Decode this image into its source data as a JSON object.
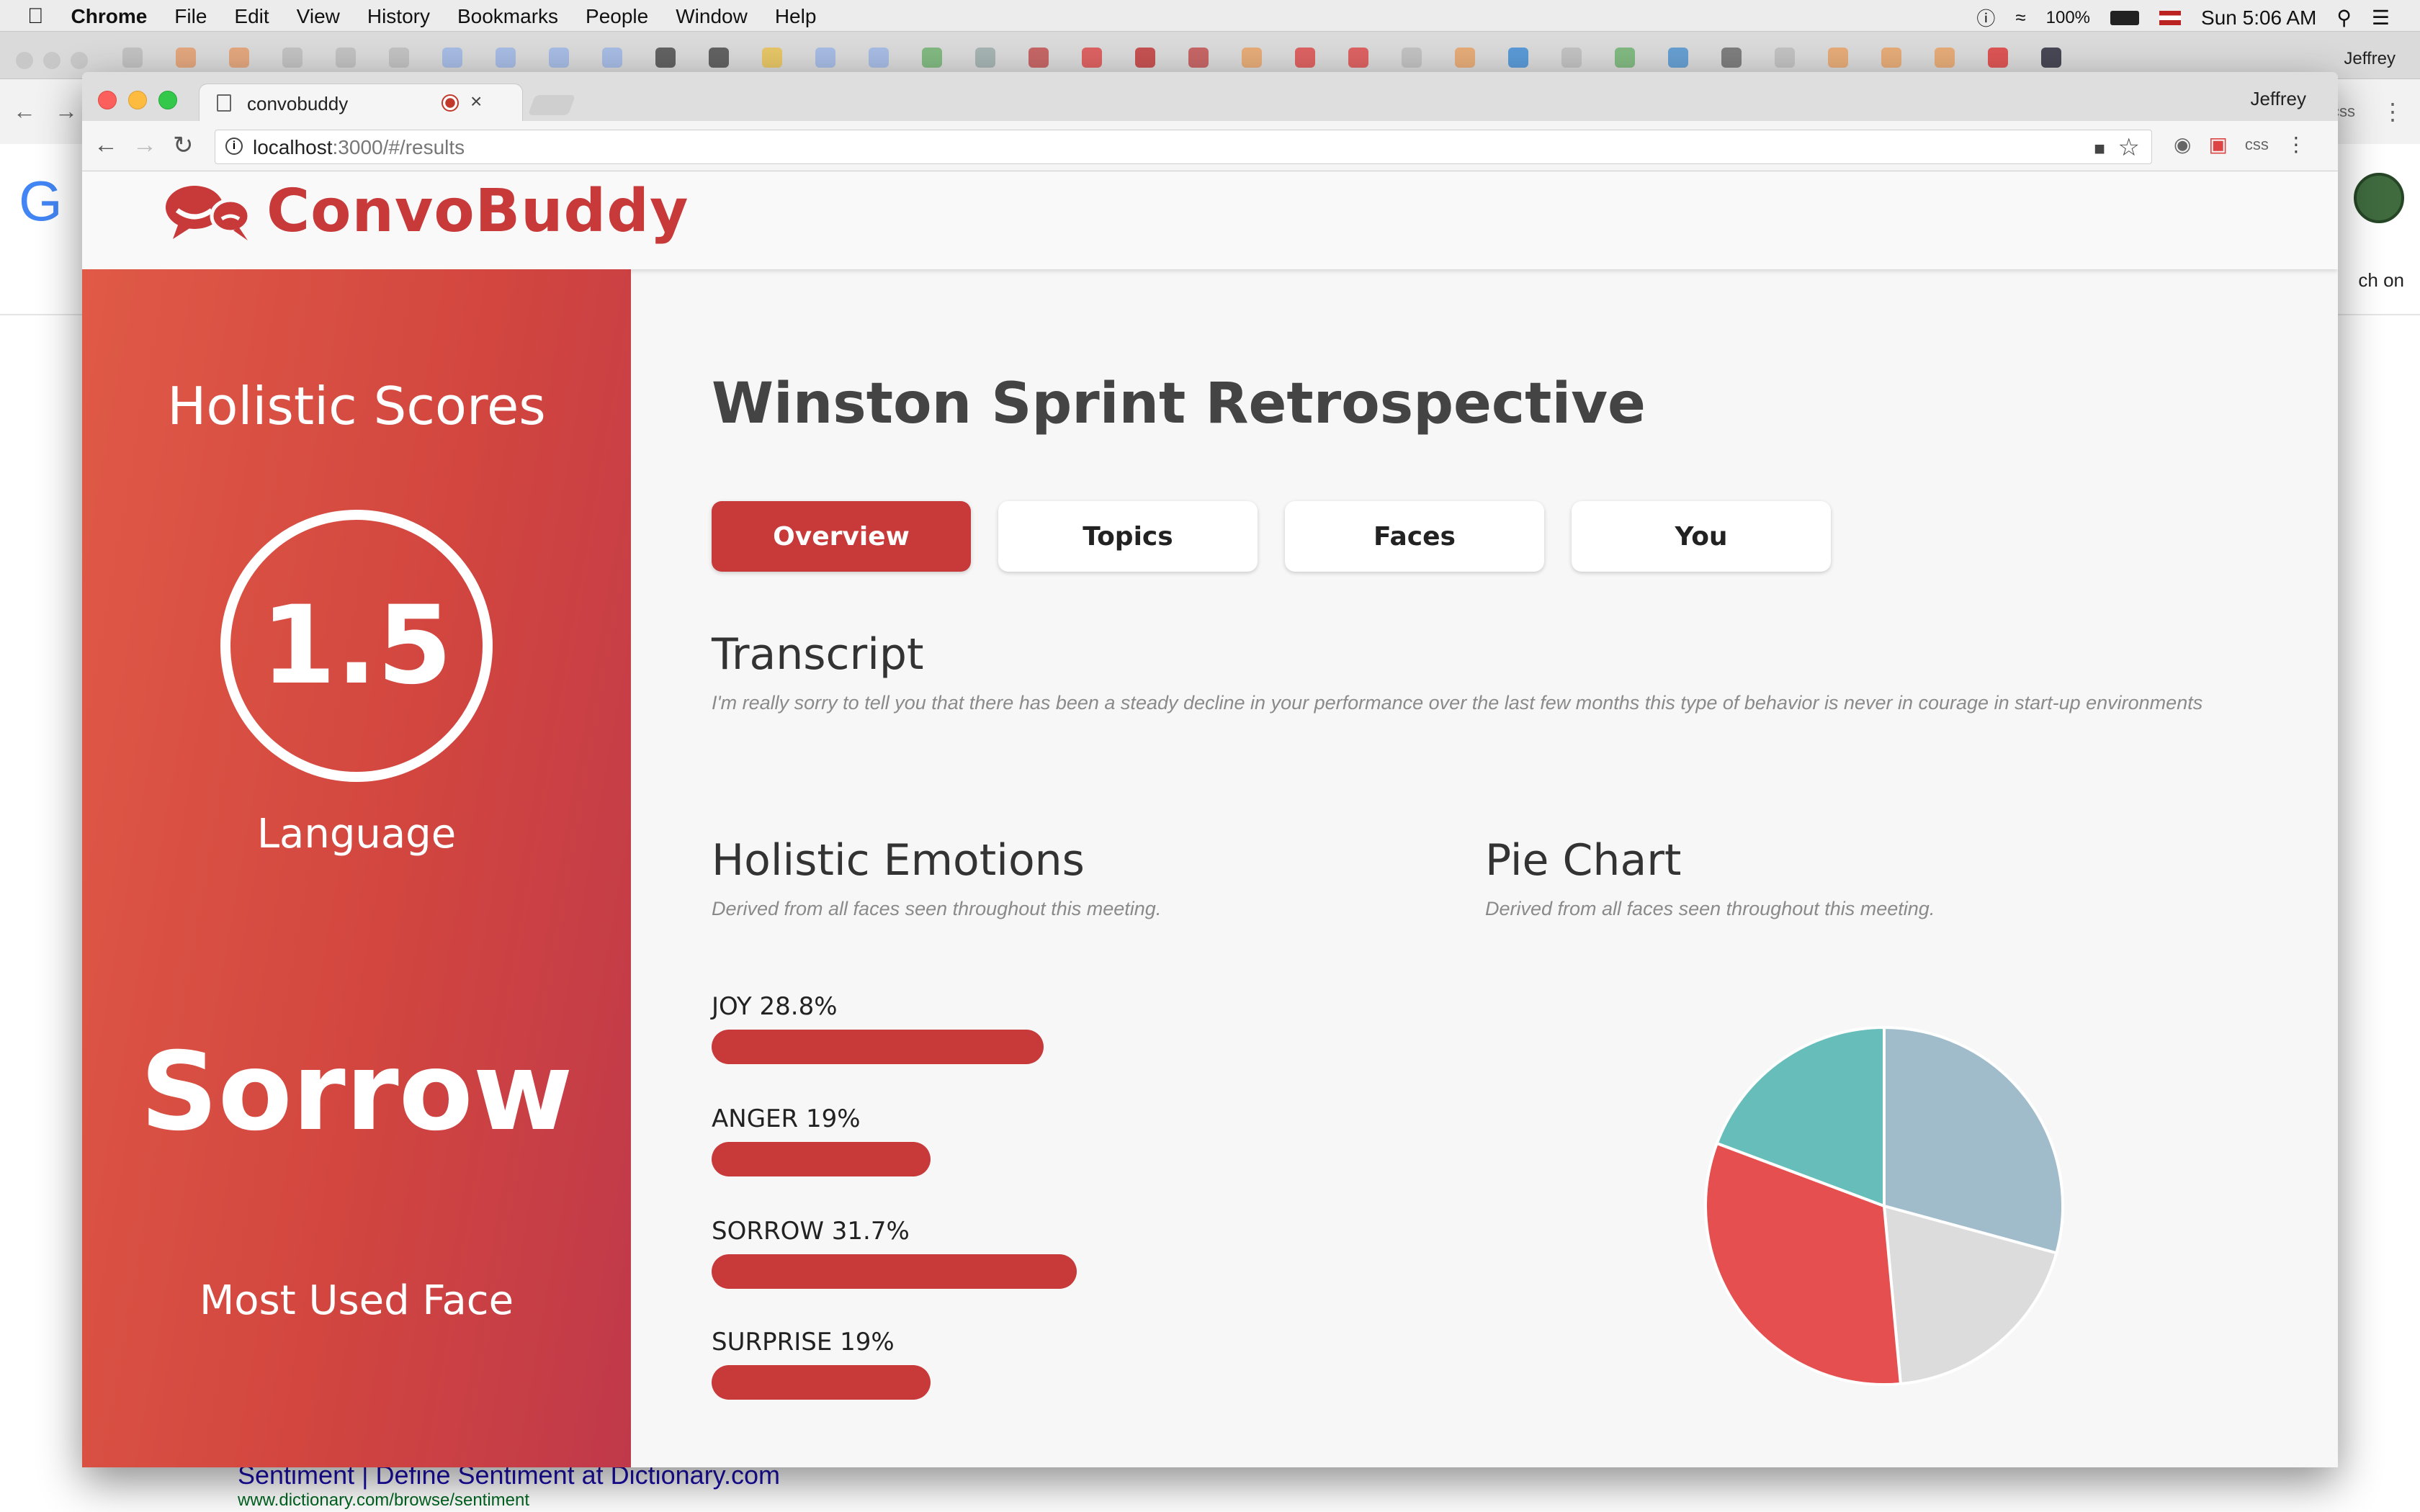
{
  "menubar": {
    "app": "Chrome",
    "menus": [
      "File",
      "Edit",
      "View",
      "History",
      "Bookmarks",
      "People",
      "Window",
      "Help"
    ],
    "battery": "100%",
    "clock": "Sun 5:06 AM"
  },
  "background": {
    "profile": "Jeffrey",
    "snippet": "ch on",
    "result_title": "Sentiment | Define Sentiment at Dictionary.com",
    "result_url": "www.dictionary.com/browse/sentiment"
  },
  "window": {
    "tab_title": "convobuddy",
    "profile": "Jeffrey",
    "url_host": "localhost",
    "url_rest": ":3000/#/results",
    "ext_css": "css"
  },
  "app": {
    "brand": "ConvoBuddy",
    "sidebar": {
      "heading": "Holistic Scores",
      "score": "1.5",
      "score_label": "Language",
      "emotion": "Sorrow",
      "emotion_label": "Most Used Face"
    },
    "meeting_title": "Winston Sprint Retrospective",
    "tabs": [
      "Overview",
      "Topics",
      "Faces",
      "You"
    ],
    "active_tab": "Overview",
    "transcript": {
      "heading": "Transcript",
      "text": "I'm really sorry to tell you that there has been a steady decline in your performance over the last few months this type of behavior is never in courage in start-up environments"
    },
    "holistic": {
      "heading": "Holistic Emotions",
      "subtitle": "Derived from all faces seen throughout this meeting.",
      "items": [
        {
          "label": "JOY 28.8%",
          "value": 28.8
        },
        {
          "label": "ANGER 19%",
          "value": 19
        },
        {
          "label": "SORROW 31.7%",
          "value": 31.7
        },
        {
          "label": "SURPRISE 19%",
          "value": 19
        }
      ]
    },
    "pie": {
      "heading": "Pie Chart",
      "subtitle": "Derived from all faces seen throughout this meeting."
    }
  },
  "chart_data": {
    "type": "pie",
    "categories": [
      "JOY",
      "ANGER",
      "SORROW",
      "SURPRISE"
    ],
    "values": [
      28.8,
      19,
      31.7,
      19
    ],
    "colors": [
      "#a0bccb",
      "#dcdcdc",
      "#e54f4f",
      "#66bdba"
    ]
  },
  "colors": {
    "brand_red": "#c8393a",
    "sidebar_start": "#e05a47",
    "sidebar_end": "#c0394a"
  }
}
